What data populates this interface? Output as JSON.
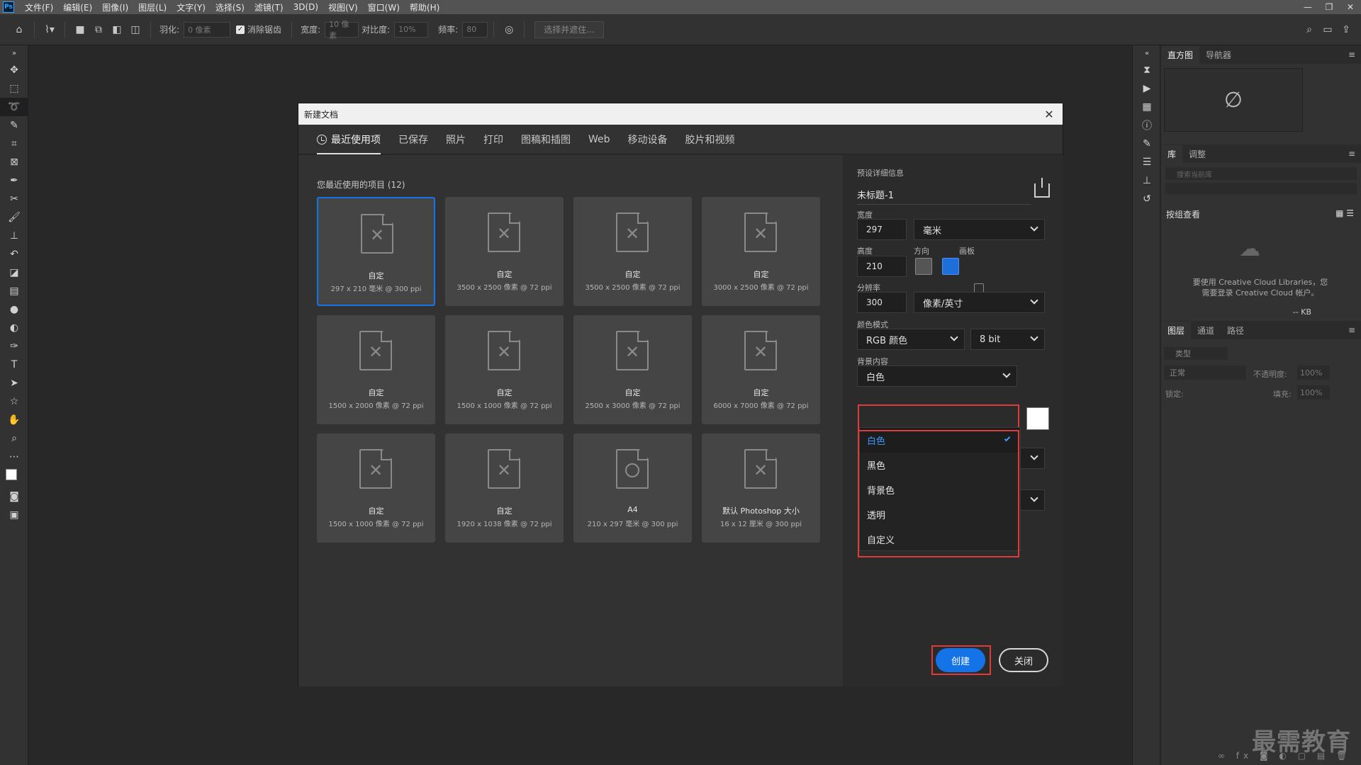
{
  "menubar": {
    "logo": "Ps",
    "items": [
      "文件(F)",
      "编辑(E)",
      "图像(I)",
      "图层(L)",
      "文字(Y)",
      "选择(S)",
      "滤镜(T)",
      "3D(D)",
      "视图(V)",
      "窗口(W)",
      "帮助(H)"
    ],
    "window_controls": [
      "—",
      "❐",
      "✕"
    ]
  },
  "options_bar": {
    "feather_label": "羽化:",
    "feather_value": "0 像素",
    "antialias_label": "消除锯齿",
    "width_label": "宽度:",
    "width_value": "10 像素",
    "contrast_label": "对比度:",
    "contrast_value": "10%",
    "frequency_label": "频率:",
    "frequency_value": "80",
    "select_mask_label": "选择并遮住..."
  },
  "right_panels": {
    "top_tabs": [
      "直方图",
      "导航器"
    ],
    "library_tabs": [
      "库",
      "调整"
    ],
    "library_search_placeholder": "搜索当前库",
    "group_view_label": "按组查看",
    "library_message": "要使用 Creative Cloud Libraries，您需要登录 Creative Cloud 帐户。",
    "library_size": "-- KB",
    "layer_tabs": [
      "图层",
      "通道",
      "路径"
    ],
    "layer_filter": "类型",
    "blend_mode": "正常",
    "opacity_label": "不透明度:",
    "opacity_value": "100%",
    "lock_label": "锁定:",
    "fill_label": "填充:",
    "fill_value": "100%"
  },
  "dialog": {
    "title": "新建文档",
    "tabs": [
      "最近使用项",
      "已保存",
      "照片",
      "打印",
      "图稿和插图",
      "Web",
      "移动设备",
      "胶片和视频"
    ],
    "recent_title": "您最近使用的项目 (12)",
    "recent_items": [
      {
        "name": "自定",
        "size": "297 x 210 毫米 @ 300 ppi"
      },
      {
        "name": "自定",
        "size": "3500 x 2500 像素 @ 72 ppi"
      },
      {
        "name": "自定",
        "size": "3500 x 2500 像素 @ 72 ppi"
      },
      {
        "name": "自定",
        "size": "3000 x 2500 像素 @ 72 ppi"
      },
      {
        "name": "自定",
        "size": "1500 x 2000 像素 @ 72 ppi"
      },
      {
        "name": "自定",
        "size": "1500 x 1000 像素 @ 72 ppi"
      },
      {
        "name": "自定",
        "size": "2500 x 3000 像素 @ 72 ppi"
      },
      {
        "name": "自定",
        "size": "6000 x 7000 像素 @ 72 ppi"
      },
      {
        "name": "自定",
        "size": "1500 x 1000 像素 @ 72 ppi"
      },
      {
        "name": "自定",
        "size": "1920 x 1038 像素 @ 72 ppi"
      },
      {
        "name": "A4",
        "size": "210 x 297 毫米 @ 300 ppi"
      },
      {
        "name": "默认 Photoshop 大小",
        "size": "16 x 12 厘米 @ 300 ppi"
      }
    ],
    "preset_details_label": "预设详细信息",
    "preset_name": "未标题-1",
    "width_label": "宽度",
    "width_value": "297",
    "width_unit": "毫米",
    "height_label": "高度",
    "height_value": "210",
    "orientation_label": "方向",
    "artboard_label": "画板",
    "resolution_label": "分辨率",
    "resolution_value": "300",
    "resolution_unit": "像素/英寸",
    "color_mode_label": "颜色模式",
    "color_mode_value": "RGB 颜色",
    "bit_depth": "8 bit",
    "background_label": "背景内容",
    "background_value": "白色",
    "background_options": [
      "白色",
      "黑色",
      "背景色",
      "透明",
      "自定义"
    ],
    "create_label": "创建",
    "close_label": "关闭"
  },
  "watermark": "最需教育",
  "colors": {
    "accent": "#1473e6",
    "highlight": "#e03a3a"
  }
}
